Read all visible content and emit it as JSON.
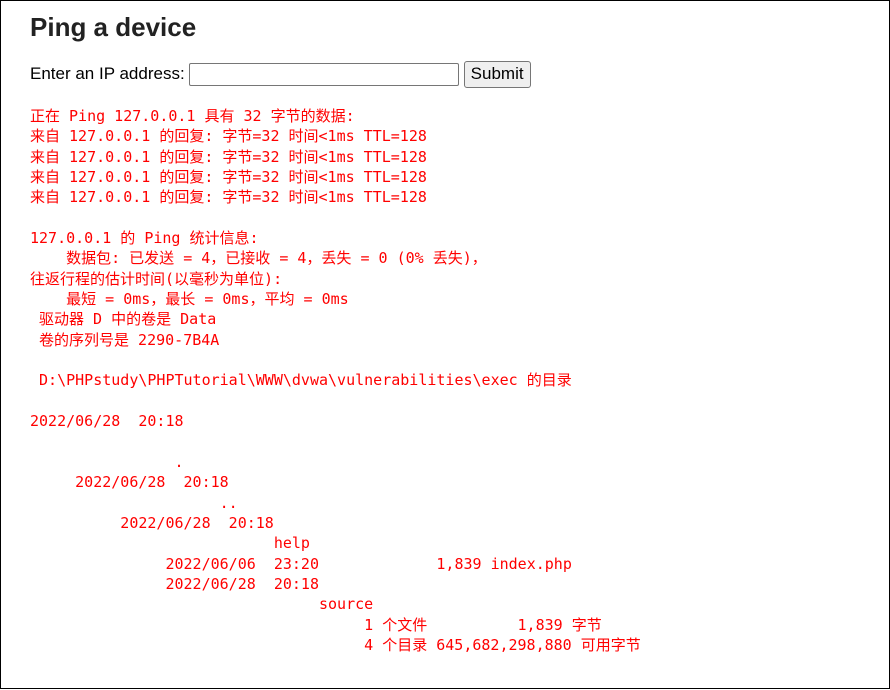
{
  "page": {
    "title": "Ping a device"
  },
  "form": {
    "label": "Enter an IP address:",
    "input_value": "",
    "submit_label": "Submit"
  },
  "output": {
    "color": "#ff0000",
    "lines": [
      "正在 Ping 127.0.0.1 具有 32 字节的数据:",
      "来自 127.0.0.1 的回复: 字节=32 时间<1ms TTL=128",
      "来自 127.0.0.1 的回复: 字节=32 时间<1ms TTL=128",
      "来自 127.0.0.1 的回复: 字节=32 时间<1ms TTL=128",
      "来自 127.0.0.1 的回复: 字节=32 时间<1ms TTL=128",
      "",
      "127.0.0.1 的 Ping 统计信息:",
      "    数据包: 已发送 = 4，已接收 = 4，丢失 = 0 (0% 丢失)，",
      "往返行程的估计时间(以毫秒为单位):",
      "    最短 = 0ms，最长 = 0ms，平均 = 0ms",
      " 驱动器 D 中的卷是 Data",
      " 卷的序列号是 2290-7B4A",
      "",
      " D:\\PHPstudy\\PHPTutorial\\WWW\\dvwa\\vulnerabilities\\exec 的目录",
      "",
      "2022/06/28  20:18",
      "",
      "                .",
      "     2022/06/28  20:18",
      "                     ..",
      "          2022/06/28  20:18",
      "                           help",
      "               2022/06/06  23:20             1,839 index.php",
      "               2022/06/28  20:18",
      "                                source",
      "                                     1 个文件          1,839 字节",
      "                                     4 个目录 645,682,298,880 可用字节"
    ]
  }
}
